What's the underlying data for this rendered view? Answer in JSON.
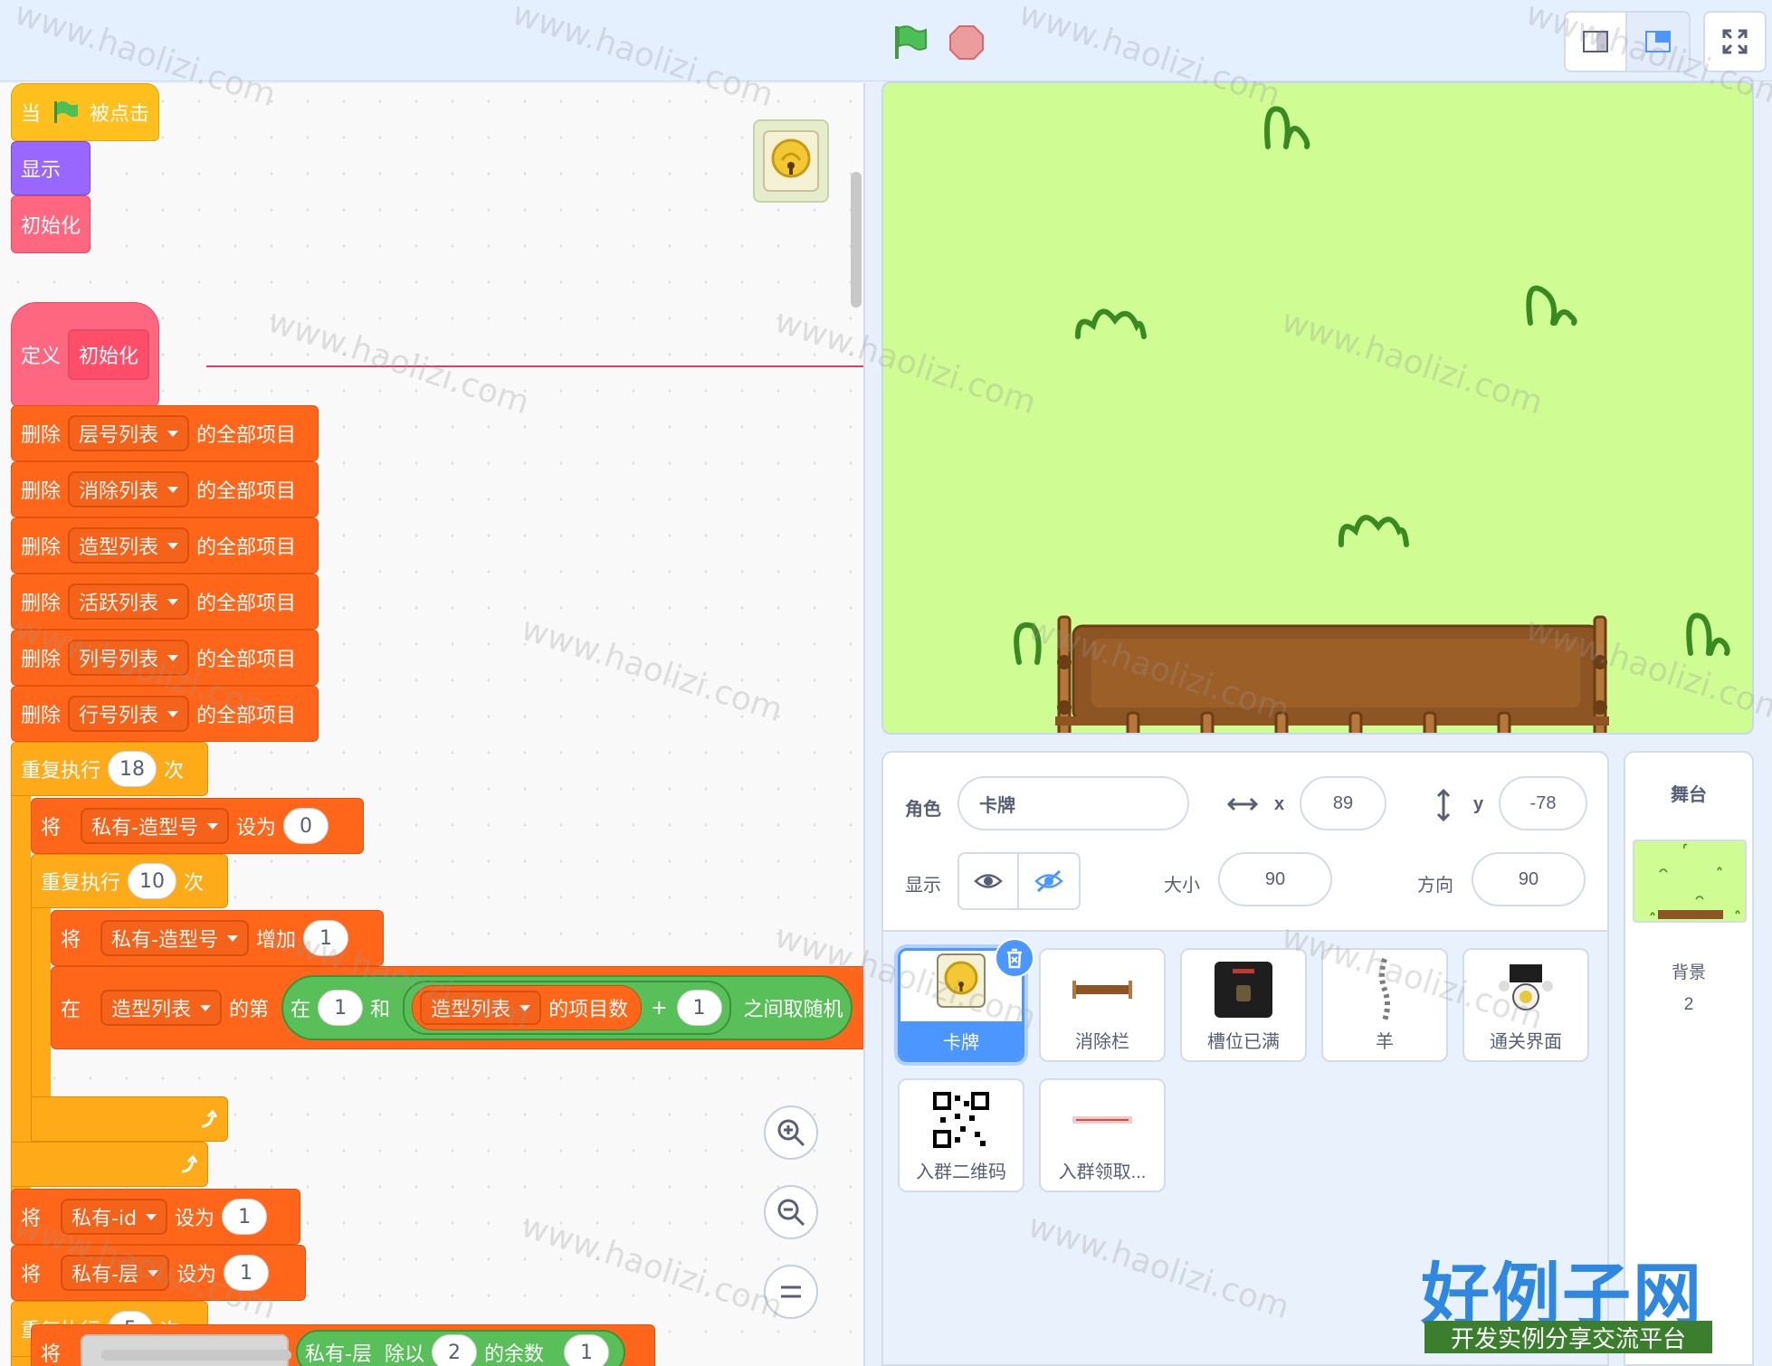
{
  "code": {
    "event_hat": {
      "when": "当",
      "clicked": "被点击"
    },
    "show_block": "显示",
    "call_init": "初始化",
    "define": {
      "label": "定义",
      "name": "初始化"
    },
    "delete_rows": [
      {
        "verb": "删除",
        "list": "层号列表",
        "suffix": "的全部项目"
      },
      {
        "verb": "删除",
        "list": "消除列表",
        "suffix": "的全部项目"
      },
      {
        "verb": "删除",
        "list": "造型列表",
        "suffix": "的全部项目"
      },
      {
        "verb": "删除",
        "list": "活跃列表",
        "suffix": "的全部项目"
      },
      {
        "verb": "删除",
        "list": "列号列表",
        "suffix": "的全部项目"
      },
      {
        "verb": "删除",
        "list": "行号列表",
        "suffix": "的全部项目"
      }
    ],
    "repeat1": {
      "label": "重复执行",
      "count": "18",
      "times": "次"
    },
    "set_costume": {
      "verb": "将",
      "var": "私有-造型号",
      "to": "设为",
      "value": "0"
    },
    "repeat2": {
      "label": "重复执行",
      "count": "10",
      "times": "次"
    },
    "change_costume": {
      "verb": "将",
      "var": "私有-造型号",
      "by": "增加",
      "value": "1"
    },
    "insert_row": {
      "at": "在",
      "list": "造型列表",
      "of": "的第",
      "between": "在",
      "from": "1",
      "and": "和",
      "list2": "造型列表",
      "length": "的项目数",
      "plus": "+",
      "add": "1",
      "random": "之间取随机"
    },
    "set_id": {
      "verb": "将",
      "var": "私有-id",
      "to": "设为",
      "value": "1"
    },
    "set_layer": {
      "verb": "将",
      "var": "私有-层",
      "to": "设为",
      "value": "1"
    },
    "repeat3": {
      "label": "重复执行",
      "count": "5",
      "times": "次"
    },
    "partial_row": {
      "verb": "将",
      "var": "私有-层",
      "op": "除以",
      "value": "2",
      "result": "的余数",
      "add": "1"
    }
  },
  "sprite_info": {
    "sprite_label": "角色",
    "sprite_name": "卡牌",
    "x_label": "x",
    "x_value": "89",
    "y_label": "y",
    "y_value": "-78",
    "show_label": "显示",
    "size_label": "大小",
    "size_value": "90",
    "direction_label": "方向",
    "direction_value": "90"
  },
  "sprites": [
    {
      "name": "卡牌",
      "selected": true
    },
    {
      "name": "消除栏"
    },
    {
      "name": "槽位已满"
    },
    {
      "name": "羊"
    },
    {
      "name": "通关界面"
    },
    {
      "name": "入群二维码"
    },
    {
      "name": "入群领取..."
    }
  ],
  "stage_pane": {
    "title": "舞台",
    "backdrop_label": "背景",
    "backdrop_count": "2"
  },
  "watermark": {
    "text": "www.haolizi.com",
    "logo": "好例子网",
    "tagline": "开发实例分享交流平台"
  },
  "colors": {
    "events": "#ffbf1c",
    "looks": "#9966ff",
    "myblocks": "#ff6680",
    "data": "#ff661a",
    "control": "#ffab19",
    "operators": "#59c059",
    "accent": "#4c97ff",
    "stage_bg": "#cffc93"
  }
}
